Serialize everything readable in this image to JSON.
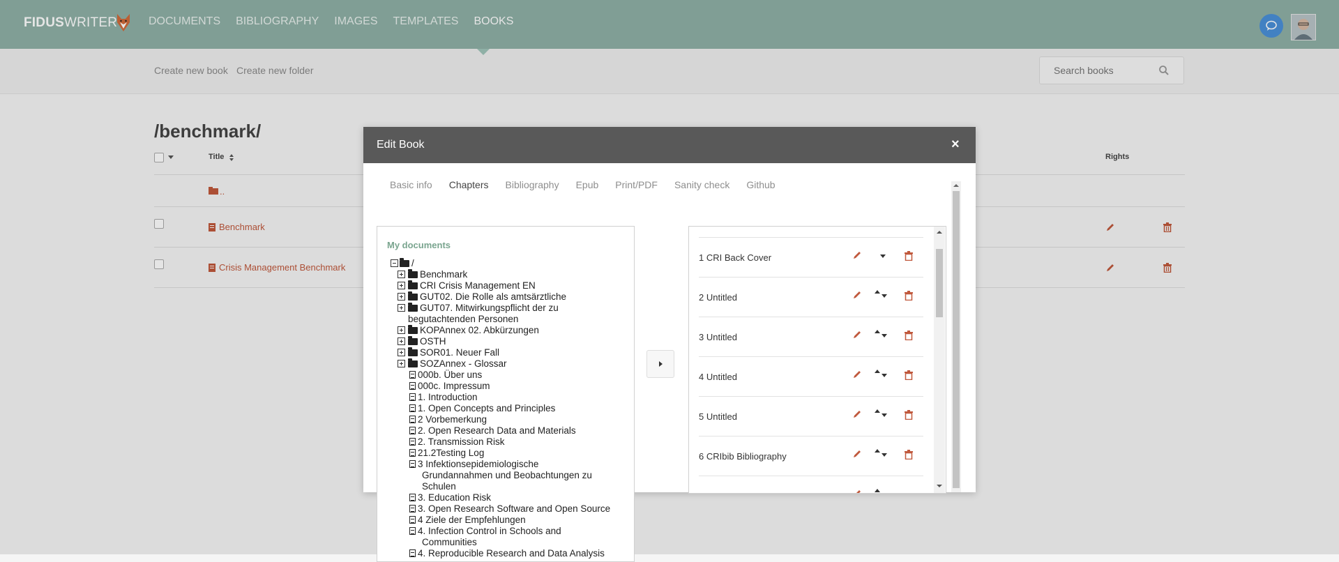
{
  "app": {
    "logo_bold": "FIDUS",
    "logo_thin": "WRITER"
  },
  "nav": {
    "items": [
      "DOCUMENTS",
      "BIBLIOGRAPHY",
      "IMAGES",
      "TEMPLATES",
      "BOOKS"
    ],
    "active": "BOOKS"
  },
  "subbar": {
    "create_book": "Create new book",
    "create_folder": "Create new folder",
    "search_placeholder": "Search books"
  },
  "main": {
    "folder_title": "/benchmark/",
    "columns": {
      "title": "Title",
      "rights": "Rights"
    },
    "parent_link": "..",
    "books": [
      "Benchmark",
      "Crisis Management Benchmark"
    ]
  },
  "dialog": {
    "title": "Edit Book",
    "close": "×",
    "tabs": [
      "Basic info",
      "Chapters",
      "Bibliography",
      "Epub",
      "Print/PDF",
      "Sanity check",
      "Github"
    ],
    "active_tab": "Chapters",
    "left": {
      "heading": "My documents",
      "root": "/",
      "folders": [
        "Benchmark",
        "CRI Crisis Management EN",
        "GUT02. Die Rolle als amtsärztliche",
        "GUT07. Mitwirkungspflicht der zu",
        "KOPAnnex 02. Abkürzungen",
        "OSTH",
        "SOR01. Neuer Fall",
        "SOZAnnex - Glossar"
      ],
      "folder_continuation": "begutachtenden Personen",
      "documents": [
        "000b. Über uns",
        "000c. Impressum",
        "1. Introduction",
        "1. Open Concepts and Principles",
        "2 Vorbemerkung",
        "2. Open Research Data and Materials",
        "2. Transmission Risk",
        "21.2Testing Log",
        "3 Infektionsepidemiologische",
        "3. Education Risk",
        "3. Open Research Software and Open Source",
        "4 Ziele der Empfehlungen",
        "4. Infection Control in Schools and",
        "4. Reproducible Research and Data Analysis"
      ],
      "doc_continuations": {
        "epi_line2": "Grundannahmen und Beobachtungen zu",
        "epi_line3": "Schulen",
        "infection_line2": "Communities"
      }
    },
    "chapters": [
      "1 CRI Back Cover",
      "2 Untitled",
      "3 Untitled",
      "4 Untitled",
      "5 Untitled",
      "6 CRIbib Bibliography"
    ]
  },
  "colors": {
    "nav_bg": "#8fb0a6",
    "accent_red": "#c0583c",
    "dialog_header": "#595959",
    "docs_heading": "#7aa58f"
  }
}
